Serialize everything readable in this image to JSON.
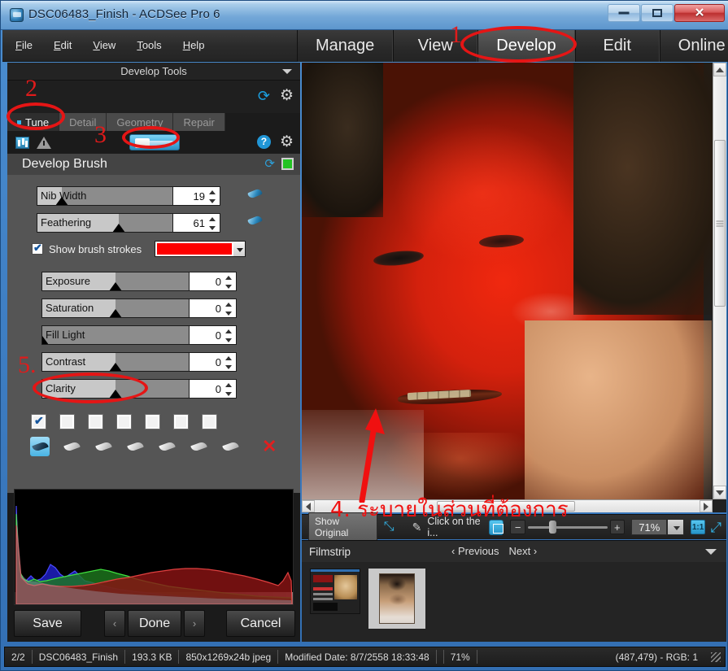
{
  "window": {
    "title": "DSC06483_Finish - ACDSee Pro 6",
    "icon": "app-icon",
    "minimize_label": "",
    "maximize_label": "",
    "close_label": "✕"
  },
  "menubar": {
    "items": [
      {
        "label": "File",
        "accel": "F"
      },
      {
        "label": "Edit",
        "accel": "E"
      },
      {
        "label": "View",
        "accel": "V"
      },
      {
        "label": "Tools",
        "accel": "T"
      },
      {
        "label": "Help",
        "accel": "H"
      }
    ]
  },
  "nav_tabs": [
    {
      "label": "Manage",
      "active": false
    },
    {
      "label": "View",
      "active": false
    },
    {
      "label": "Develop",
      "active": true
    },
    {
      "label": "Edit",
      "active": false
    },
    {
      "label": "Online",
      "active": false
    }
  ],
  "left_panel": {
    "header_title": "Develop Tools",
    "toolbar_icons": [
      "refresh-icon",
      "gear-icon"
    ],
    "tool_tabs": [
      {
        "label": "Tune",
        "active": true
      },
      {
        "label": "Detail",
        "active": false
      },
      {
        "label": "Geometry",
        "active": false
      },
      {
        "label": "Repair",
        "active": false
      }
    ],
    "brush_bar_icons": [
      "histogram-icon",
      "warning-icon",
      "develop-brush-tool-icon",
      "help-icon",
      "gear-icon"
    ],
    "section_title": "Develop Brush",
    "section_icons": [
      "reset-icon",
      "enable-toggle-icon"
    ],
    "brush_sliders": [
      {
        "label": "Nib Width",
        "value": "19",
        "fill_pct": 18
      },
      {
        "label": "Feathering",
        "value": "61",
        "fill_pct": 60
      }
    ],
    "show_brush_strokes": {
      "label": "Show brush strokes",
      "checked": true,
      "color": "#fd0000"
    },
    "adjust_sliders": [
      {
        "label": "Exposure",
        "value": "0",
        "fill_pct": 50
      },
      {
        "label": "Saturation",
        "value": "0",
        "fill_pct": 50
      },
      {
        "label": "Fill Light",
        "value": "0",
        "fill_pct": 0
      },
      {
        "label": "Contrast",
        "value": "0",
        "fill_pct": 50
      },
      {
        "label": "Clarity",
        "value": "0",
        "fill_pct": 50
      }
    ],
    "preset_checkboxes": [
      true,
      false,
      false,
      false,
      false,
      false,
      false
    ],
    "preset_brushes": [
      true,
      false,
      false,
      false,
      false,
      false,
      false
    ],
    "delete_icon": "red-x-icon",
    "buttons": {
      "save": "Save",
      "prev": "‹",
      "done": "Done",
      "next": "›",
      "cancel": "Cancel"
    }
  },
  "view_toolbar": {
    "show_original": "Show Original",
    "compare_icon": "compare-arrows-icon",
    "wand_icon": "magic-wand-icon",
    "hint": "Click on the i...",
    "fit_icon": "fit-to-window-icon",
    "zoom_out": "−",
    "zoom_in": "+",
    "zoom_value": "71%",
    "zoom_dropdown_icon": "chevron-down-icon",
    "actual_size": "1:1",
    "fullscreen_icon": "expand-icon"
  },
  "filmstrip": {
    "title": "Filmstrip",
    "previous": "Previous",
    "next": "Next",
    "caret_icon": "chevron-down-icon",
    "thumbs": [
      {
        "name": "screenshot-thumbnail",
        "selected": false
      },
      {
        "name": "portrait-thumbnail",
        "selected": true
      }
    ]
  },
  "statusbar": {
    "index": "2/2",
    "filename": "DSC06483_Finish",
    "filesize": "193.3 KB",
    "dimensions": "850x1269x24b jpeg",
    "modified": "Modified Date: 8/7/2558 18:33:48",
    "zoom": "71%",
    "cursor": "(487,479) - RGB: 1"
  },
  "annotations": {
    "n1": "1",
    "n2": "2",
    "n3": "3",
    "n5": "5.",
    "thai_step4": "4. ระบายในส่วนที่ต้องการ",
    "color": "#e51515"
  }
}
